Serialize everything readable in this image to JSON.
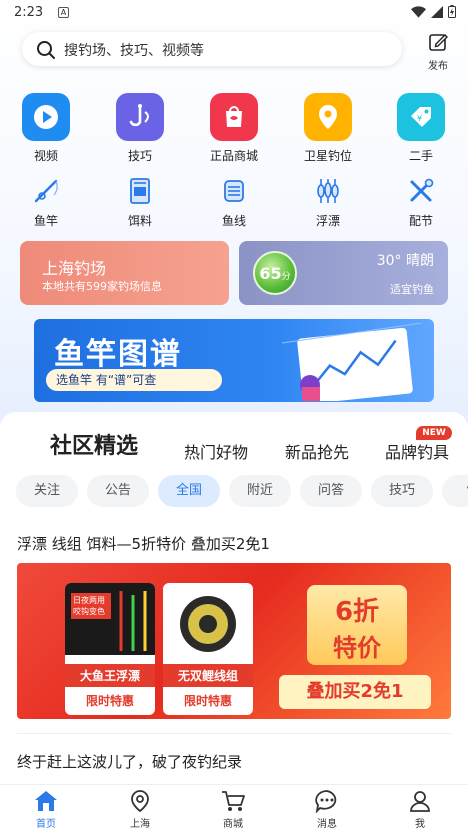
{
  "status": {
    "time": "2:23",
    "a_badge": "A"
  },
  "search": {
    "placeholder": "搜钓场、技巧、视频等"
  },
  "publish": {
    "label": "发布"
  },
  "grid_top": [
    {
      "label": "视频",
      "color": "#1e8cf0"
    },
    {
      "label": "技巧",
      "color": "#6b63e6"
    },
    {
      "label": "正品商城",
      "color": "#f0374c"
    },
    {
      "label": "卫星钓位",
      "color": "#ffb300"
    },
    {
      "label": "二手",
      "color": "#1cc2e0"
    }
  ],
  "grid_bottom": [
    {
      "label": "鱼竿"
    },
    {
      "label": "饵料"
    },
    {
      "label": "鱼线"
    },
    {
      "label": "浮漂"
    },
    {
      "label": "配节"
    }
  ],
  "location_card": {
    "title": "上海钓场",
    "subtitle": "本地共有599家钓场信息"
  },
  "weather_card": {
    "score": "65",
    "unit": "分",
    "weather": "30° 晴朗",
    "fishing": "适宜钓鱼"
  },
  "banner": {
    "title": "鱼竿图谱",
    "subtitle": "选鱼竿 有“谱”可查"
  },
  "tabs": [
    "社区精选",
    "热门好物",
    "新品抢先",
    "品牌钓具"
  ],
  "new_badge": "NEW",
  "chips": [
    "关注",
    "公告",
    "全国",
    "附近",
    "问答",
    "技巧",
    "饵"
  ],
  "posts": [
    {
      "title": "浮漂 线组 饵料—5折特价 叠加买2免1"
    },
    {
      "title": "终于赶上这波儿了，破了夜钓纪录"
    }
  ],
  "promo": {
    "prod1_top": "日夜两用 咬钩变色",
    "prod1_name": "大鱼王浮漂",
    "prod1_tag": "限时特惠",
    "prod2_name": "无双鲤线组",
    "prod2_tag": "限时特惠",
    "discount": "6折",
    "discount_sub": "特价",
    "bundle": "叠加买2免1"
  },
  "nav": [
    {
      "label": "首页"
    },
    {
      "label": "上海"
    },
    {
      "label": "商城"
    },
    {
      "label": "消息"
    },
    {
      "label": "我"
    }
  ]
}
